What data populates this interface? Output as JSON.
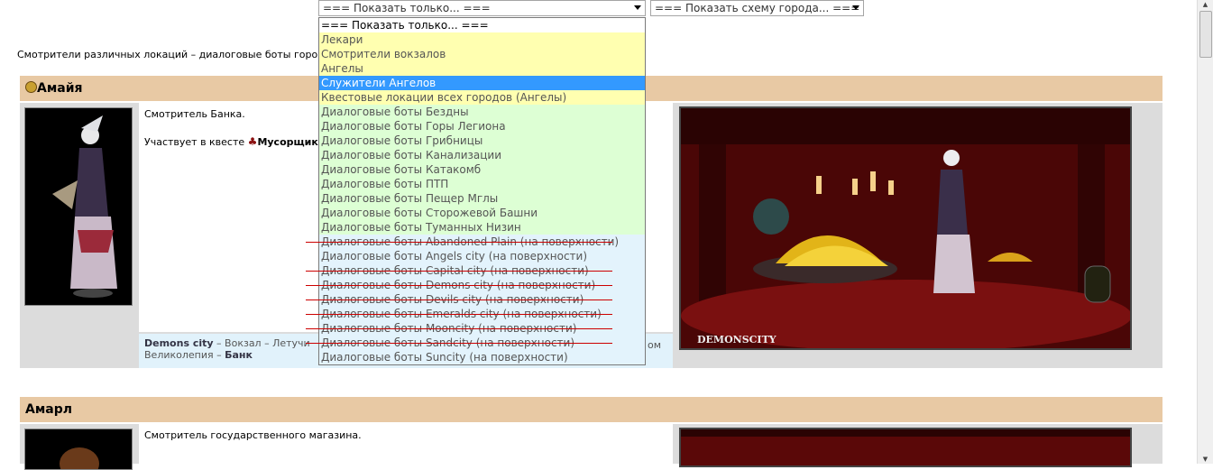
{
  "filter": {
    "selected": "=== Показать только... ===",
    "options": [
      {
        "label": "=== Показать только... ===",
        "kind": "none"
      },
      {
        "label": "Лекари",
        "kind": "yellow"
      },
      {
        "label": "Смотрители вокзалов",
        "kind": "yellow"
      },
      {
        "label": "Ангелы",
        "kind": "yellow"
      },
      {
        "label": "Служители Ангелов",
        "kind": "sel"
      },
      {
        "label": "Квестовые локации всех городов (Ангелы)",
        "kind": "yellow"
      },
      {
        "label": "Диалоговые боты Бездны",
        "kind": "green"
      },
      {
        "label": "Диалоговые боты Горы Легиона",
        "kind": "green"
      },
      {
        "label": "Диалоговые боты Грибницы",
        "kind": "green"
      },
      {
        "label": "Диалоговые боты Канализации",
        "kind": "green"
      },
      {
        "label": "Диалоговые боты Катакомб",
        "kind": "green"
      },
      {
        "label": "Диалоговые боты ПТП",
        "kind": "green"
      },
      {
        "label": "Диалоговые боты Пещер Мглы",
        "kind": "green"
      },
      {
        "label": "Диалоговые боты Сторожевой Башни",
        "kind": "green"
      },
      {
        "label": "Диалоговые боты Туманных Низин",
        "kind": "green"
      },
      {
        "label": "Диалоговые боты Abandoned Plain (на поверхности)",
        "kind": "blue"
      },
      {
        "label": "Диалоговые боты Angels city (на поверхности)",
        "kind": "blue"
      },
      {
        "label": "Диалоговые боты Capital city (на поверхности)",
        "kind": "blue"
      },
      {
        "label": "Диалоговые боты Demons city (на поверхности)",
        "kind": "blue"
      },
      {
        "label": "Диалоговые боты Devils city (на поверхности)",
        "kind": "blue"
      },
      {
        "label": "Диалоговые боты Emeralds city (на поверхности)",
        "kind": "blue"
      },
      {
        "label": "Диалоговые боты Mooncity (на поверхности)",
        "kind": "blue"
      },
      {
        "label": "Диалоговые боты Sandcity (на поверхности)",
        "kind": "blue"
      },
      {
        "label": "Диалоговые боты Suncity (на поверхности)",
        "kind": "blue"
      }
    ]
  },
  "city_map": {
    "selected": "=== Показать схему города... ==="
  },
  "intro_text": "Смотрители различных локаций – диалоговые боты горо",
  "bots": [
    {
      "name": "Амайя",
      "role": "Смотритель Банка.",
      "quest_prefix": "Участвует в квесте",
      "quest_name": "Мусорщик",
      "location_city": "Demons city",
      "location_path": "– Вокзал – Летучи",
      "location_tail": "ом",
      "location_line2_a": "Великолепия –",
      "location_line2_b": "Банк",
      "scene_caption": "DEMONSCITY"
    },
    {
      "name": "Амарл",
      "role": "Смотритель государственного магазина."
    }
  ]
}
